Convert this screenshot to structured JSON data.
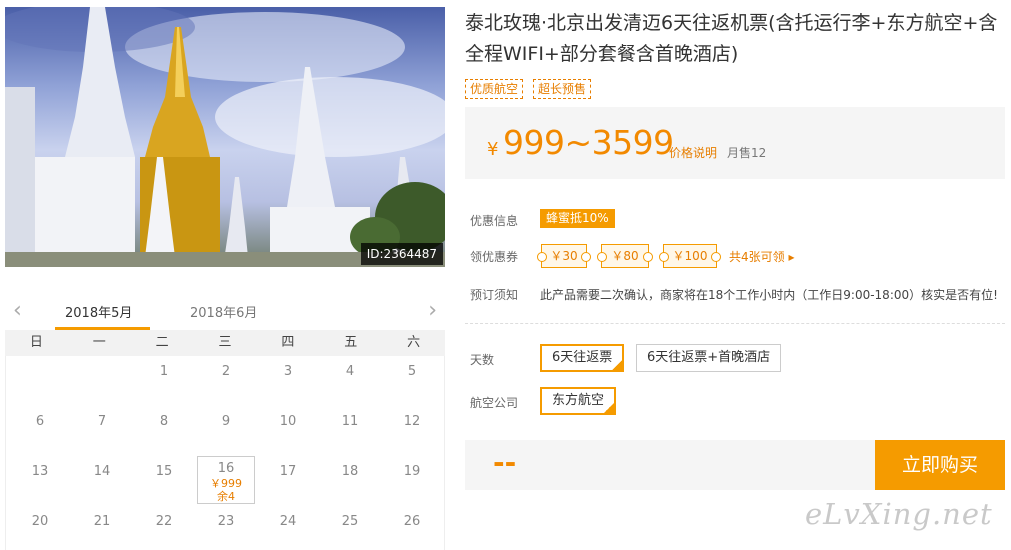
{
  "product": {
    "title": "泰北玫瑰·北京出发清迈6天往返机票(含托运行李+东方航空+含全程WIFI+部分套餐含首晚酒店)",
    "tags": [
      "优质航空",
      "超长预售"
    ],
    "price_currency": "¥",
    "price": "999~3599",
    "price_note": "价格说明",
    "monthly_sales": "月售12",
    "image_id": "ID:2364487"
  },
  "info": {
    "promo_label": "优惠信息",
    "promo_badge": "蜂蜜抵10%",
    "coupon_label": "领优惠券",
    "coupons": [
      "￥30",
      "￥80",
      "￥100"
    ],
    "coupon_more": "共4张可领 ▸",
    "notice_label": "预订须知",
    "notice_text": "此产品需要二次确认，商家将在18个工作小时内（工作日9:00-18:00）核实是否有位!"
  },
  "options": {
    "days_label": "天数",
    "days": [
      "6天往返票",
      "6天往返票+首晚酒店"
    ],
    "airline_label": "航空公司",
    "airlines": [
      "东方航空"
    ]
  },
  "buy": {
    "price_placeholder": "--",
    "button": "立即购买"
  },
  "calendar": {
    "months": [
      "2018年5月",
      "2018年6月"
    ],
    "weekdays": [
      "日",
      "一",
      "二",
      "三",
      "四",
      "五",
      "六"
    ],
    "rows": [
      [
        "",
        "",
        "1",
        "2",
        "3",
        "4",
        "5"
      ],
      [
        "6",
        "7",
        "8",
        "9",
        "10",
        "11",
        "12"
      ],
      [
        "13",
        "14",
        "15",
        "16",
        "17",
        "18",
        "19"
      ],
      [
        "20",
        "21",
        "22",
        "23",
        "24",
        "25",
        "26"
      ]
    ],
    "active_day": {
      "day": "16",
      "price": "￥999",
      "stock": "余4"
    }
  },
  "watermark": "eLvXing.net",
  "colors": {
    "accent": "#f59b00",
    "price": "#f28900",
    "text": "#333333"
  }
}
